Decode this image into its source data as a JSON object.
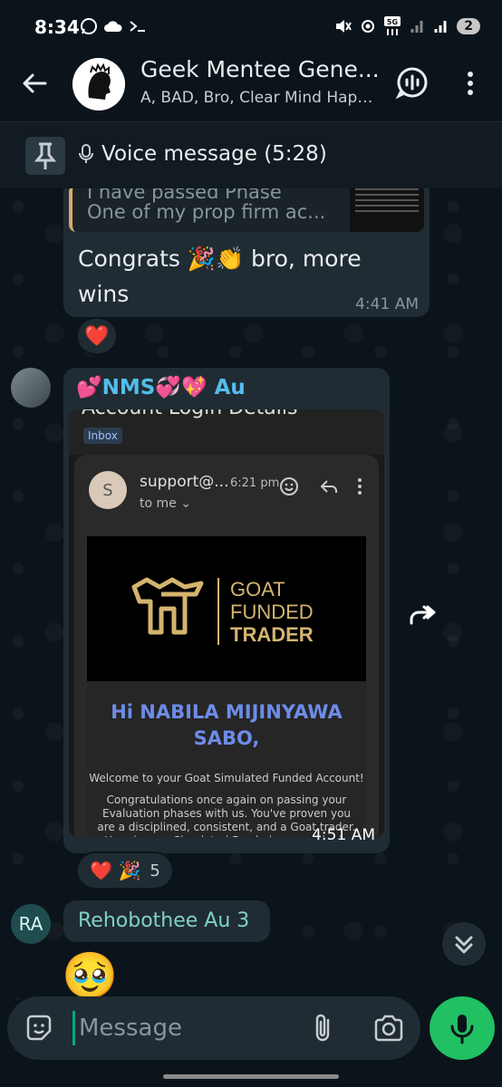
{
  "status_bar": {
    "time": "8:34",
    "battery": "2"
  },
  "header": {
    "title": "Geek Mentee Gene...",
    "subtitle": "A, BAD, Bro, Clear Mind Happ..."
  },
  "pinned": {
    "label": "Voice message (5:28)"
  },
  "messages": [
    {
      "quote_line1": "I have passed Phase",
      "quote_line2": "One of my prop firm ac...",
      "text": "Congrats 🎉👏 bro, more wins",
      "time": "4:41 AM",
      "reaction": "❤️"
    },
    {
      "sender": "💕NMS💞💖 Au",
      "time": "4:51 AM",
      "email": {
        "subject": "Account Login Details",
        "tag": "Inbox",
        "avatar_letter": "S",
        "from": "support@...",
        "sent_time": "6:21 pm",
        "to": "to me",
        "brand_line1": "GOAT",
        "brand_line2": "FUNDED",
        "brand_line3": "TRADER",
        "greeting": "Hi NABILA MIJINYAWA SABO,",
        "welcome": "Welcome to your Goat Simulated Funded Account!",
        "body": "Congratulations once again on passing your Evaluation phases with us. You've proven you are a disciplined, consistent, and a Goat trader. Here is your Simulated Funded account login credentials."
      },
      "reactions": "❤️ 🎉",
      "reaction_count": "5"
    },
    {
      "avatar_initials": "RA",
      "sender": "Rehobothee Au 3",
      "emoji": "🥹"
    }
  ],
  "input": {
    "placeholder": "Message"
  },
  "colors": {
    "accent": "#21c063",
    "bubble": "#202c33",
    "background": "#0b141a"
  }
}
